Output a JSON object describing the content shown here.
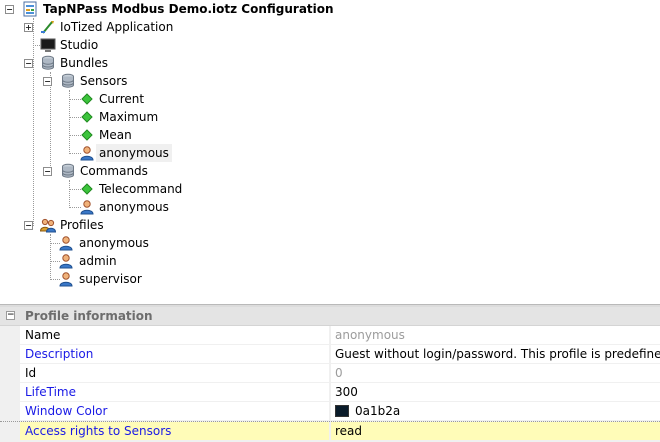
{
  "tree": {
    "root": "TapNPass Modbus Demo.iotz Configuration",
    "iotized_application": "IoTized Application",
    "studio": "Studio",
    "bundles": "Bundles",
    "sensors": "Sensors",
    "current": "Current",
    "maximum": "Maximum",
    "mean": "Mean",
    "sensors_profile": "anonymous",
    "commands": "Commands",
    "telecommand": "Telecommand",
    "commands_profile": "anonymous",
    "profiles": "Profiles",
    "profile_anonymous": "anonymous",
    "profile_admin": "admin",
    "profile_supervisor": "supervisor",
    "expand_symbol": "+",
    "collapse_symbol": "−"
  },
  "grid": {
    "section_title": "Profile information",
    "collapse_symbol": "−",
    "rows": [
      {
        "name": "Name",
        "value": "anonymous"
      },
      {
        "name": "Description",
        "value": "Guest without login/password. This profile is predefined in ..."
      },
      {
        "name": "Id",
        "value": "0"
      },
      {
        "name": "LifeTime",
        "value": "300"
      },
      {
        "name": "Window Color",
        "value": "0a1b2a"
      },
      {
        "name": "Access rights to Sensors",
        "value": "read"
      }
    ]
  },
  "colors": {
    "window_color": "#0a1b2a",
    "highlight_row": "#fffcb8",
    "link_name": "#1a1ae6"
  },
  "icons": {
    "root": "config-file-icon",
    "iotized_application": "app-pen-icon",
    "studio": "monitor-icon",
    "bundles": "database-icon",
    "sensor": "green-diamond-icon",
    "profile": "user-icon",
    "profiles_group": "users-group-icon"
  }
}
